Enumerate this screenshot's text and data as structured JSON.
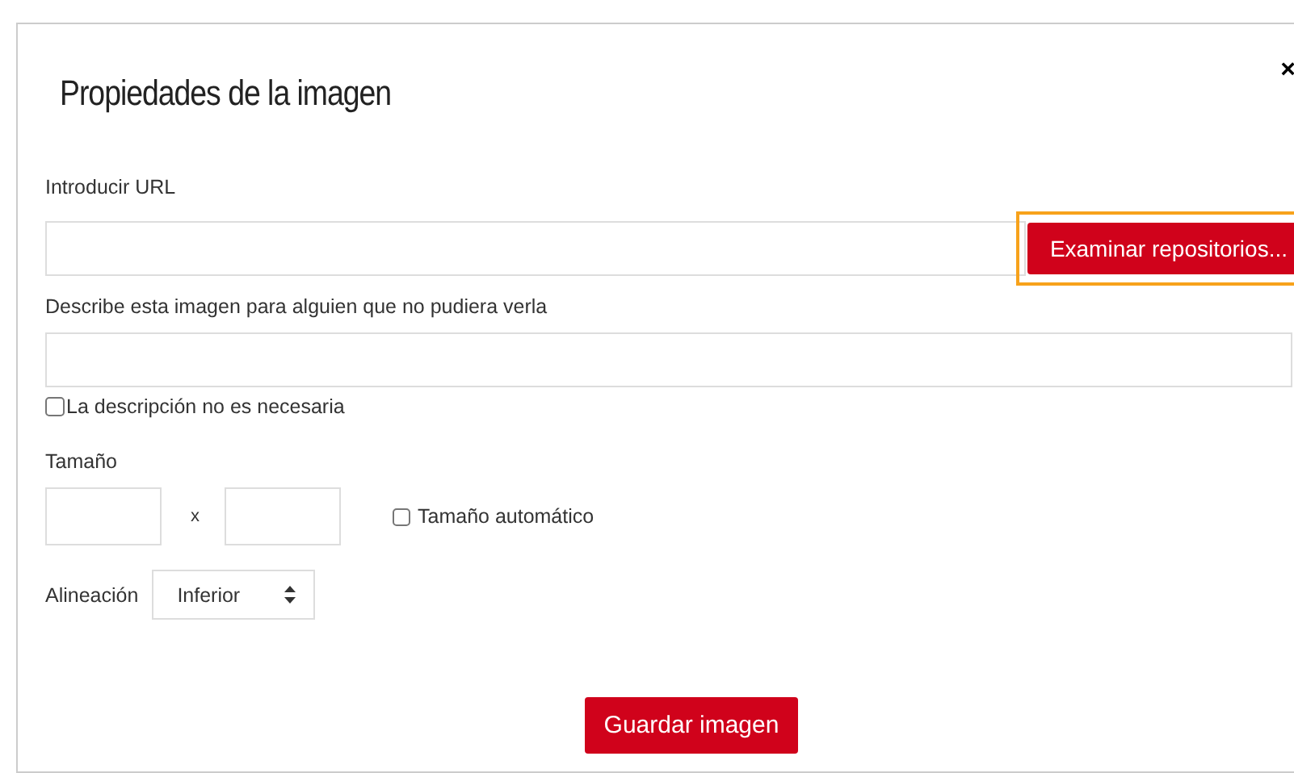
{
  "dialog": {
    "title": "Propiedades de la imagen",
    "close": "×"
  },
  "url": {
    "label": "Introducir URL",
    "browse_button": {
      "label": "Examinar repositorios...",
      "highlighted": true
    }
  },
  "description": {
    "label": "Describe esta imagen para alguien que no pudiera verla",
    "not_needed": {
      "label": "La descripción no es necesaria",
      "checked": false
    }
  },
  "size": {
    "label": "Tamaño",
    "separator": "x",
    "auto": {
      "label": "Tamaño automático",
      "checked": false
    }
  },
  "alignment": {
    "label": "Alineación",
    "value": "Inferior"
  },
  "save_button": "Guardar imagen"
}
